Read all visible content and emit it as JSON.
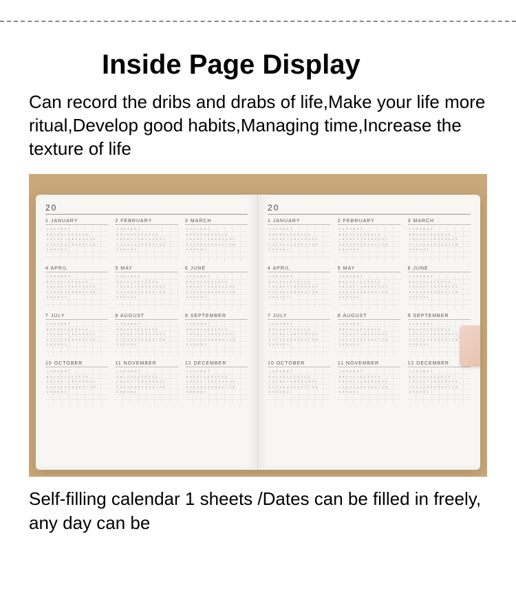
{
  "title": "Inside Page Display",
  "description": "Can record the dribs and drabs of life,Make your life more ritual,Develop good habits,Managing time,Increase the texture of life",
  "caption": "Self-filling calendar 1 sheets /Dates can be filled in freely, any day can be",
  "notebook": {
    "year_prefix": "20",
    "months": [
      {
        "num": "1",
        "name": "JANUARY"
      },
      {
        "num": "2",
        "name": "FEBRUARY"
      },
      {
        "num": "3",
        "name": "MARCH"
      },
      {
        "num": "4",
        "name": "APRIL"
      },
      {
        "num": "5",
        "name": "MAY"
      },
      {
        "num": "6",
        "name": "JUNE"
      },
      {
        "num": "7",
        "name": "JULY"
      },
      {
        "num": "8",
        "name": "AUGUST"
      },
      {
        "num": "9",
        "name": "SEPTEMBER"
      },
      {
        "num": "10",
        "name": "OCTOBER"
      },
      {
        "num": "11",
        "name": "NOVEMBER"
      },
      {
        "num": "12",
        "name": "DECEMBER"
      }
    ]
  }
}
